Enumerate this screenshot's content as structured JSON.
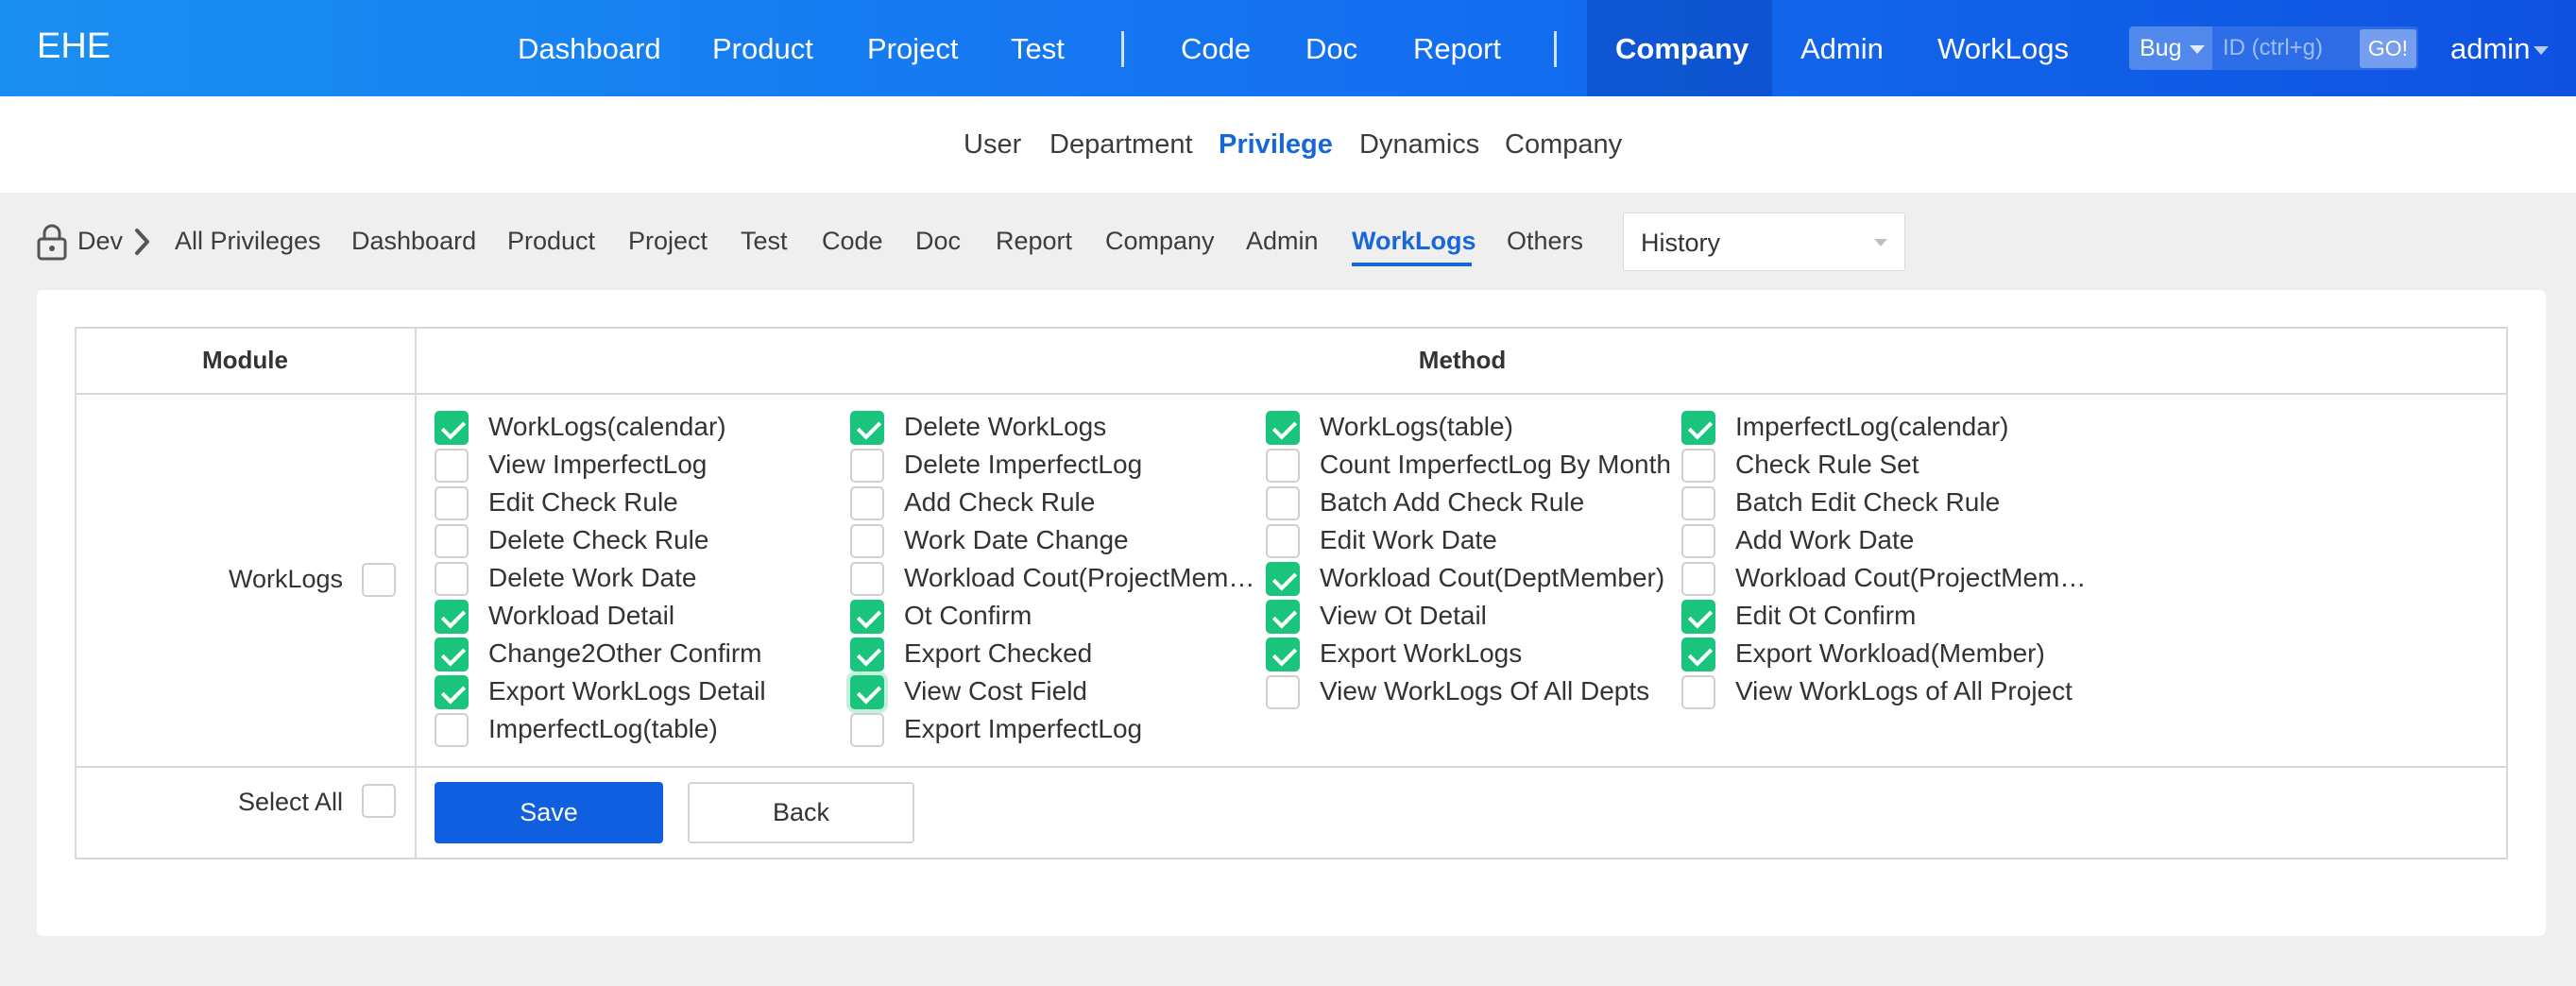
{
  "header": {
    "brand": "EHE",
    "nav": [
      "Dashboard",
      "Product",
      "Project",
      "Test",
      "Code",
      "Doc",
      "Report",
      "Company",
      "Admin",
      "WorkLogs"
    ],
    "active_nav": "Company",
    "search": {
      "type": "Bug",
      "placeholder": "ID (ctrl+g)",
      "go": "GO!"
    },
    "user": "admin"
  },
  "subnav": {
    "items": [
      "User",
      "Department",
      "Privilege",
      "Dynamics",
      "Company"
    ],
    "active": "Privilege"
  },
  "breadcrumb": {
    "group": "Dev",
    "items": [
      "All Privileges",
      "Dashboard",
      "Product",
      "Project",
      "Test",
      "Code",
      "Doc",
      "Report",
      "Company",
      "Admin",
      "WorkLogs",
      "Others"
    ],
    "active": "WorkLogs",
    "history": "History"
  },
  "table": {
    "headers": {
      "module": "Module",
      "method": "Method"
    },
    "module_name": "WorkLogs",
    "select_all": "Select All",
    "methods": [
      [
        {
          "label": "WorkLogs(calendar)",
          "checked": true
        },
        {
          "label": "View ImperfectLog",
          "checked": false
        },
        {
          "label": "Edit Check Rule",
          "checked": false
        },
        {
          "label": "Delete Check Rule",
          "checked": false
        },
        {
          "label": "Delete Work Date",
          "checked": false
        },
        {
          "label": "Workload Detail",
          "checked": true
        },
        {
          "label": "Change2Other Confirm",
          "checked": true
        },
        {
          "label": "Export WorkLogs Detail",
          "checked": true
        },
        {
          "label": "ImperfectLog(table)",
          "checked": false
        }
      ],
      [
        {
          "label": "Delete WorkLogs",
          "checked": true
        },
        {
          "label": "Delete ImperfectLog",
          "checked": false
        },
        {
          "label": "Add Check Rule",
          "checked": false
        },
        {
          "label": "Work Date Change",
          "checked": false
        },
        {
          "label": "Workload Cout(ProjectMember)",
          "checked": false
        },
        {
          "label": "Ot Confirm",
          "checked": true
        },
        {
          "label": "Export Checked",
          "checked": true
        },
        {
          "label": "View Cost Field",
          "checked": true,
          "focused": true
        },
        {
          "label": "Export ImperfectLog",
          "checked": false
        }
      ],
      [
        {
          "label": "WorkLogs(table)",
          "checked": true
        },
        {
          "label": "Count ImperfectLog By Month",
          "checked": false
        },
        {
          "label": "Batch Add Check Rule",
          "checked": false
        },
        {
          "label": "Edit Work Date",
          "checked": false
        },
        {
          "label": "Workload Cout(DeptMember)",
          "checked": true
        },
        {
          "label": "View Ot Detail",
          "checked": true
        },
        {
          "label": "Export WorkLogs",
          "checked": true
        },
        {
          "label": "View WorkLogs Of All Depts",
          "checked": false
        }
      ],
      [
        {
          "label": "ImperfectLog(calendar)",
          "checked": true
        },
        {
          "label": "Check Rule Set",
          "checked": false
        },
        {
          "label": "Batch Edit Check Rule",
          "checked": false
        },
        {
          "label": "Add Work Date",
          "checked": false
        },
        {
          "label": "Workload Cout(ProjectMember)",
          "checked": false
        },
        {
          "label": "Edit Ot Confirm",
          "checked": true
        },
        {
          "label": "Export Workload(Member)",
          "checked": true
        },
        {
          "label": "View WorkLogs of All Project",
          "checked": false
        }
      ]
    ],
    "save": "Save",
    "back": "Back"
  },
  "colors": {
    "accent": "#1667d8",
    "checked": "#1bc47d",
    "header_start": "#1a8ff3",
    "header_end": "#0f52e0"
  }
}
